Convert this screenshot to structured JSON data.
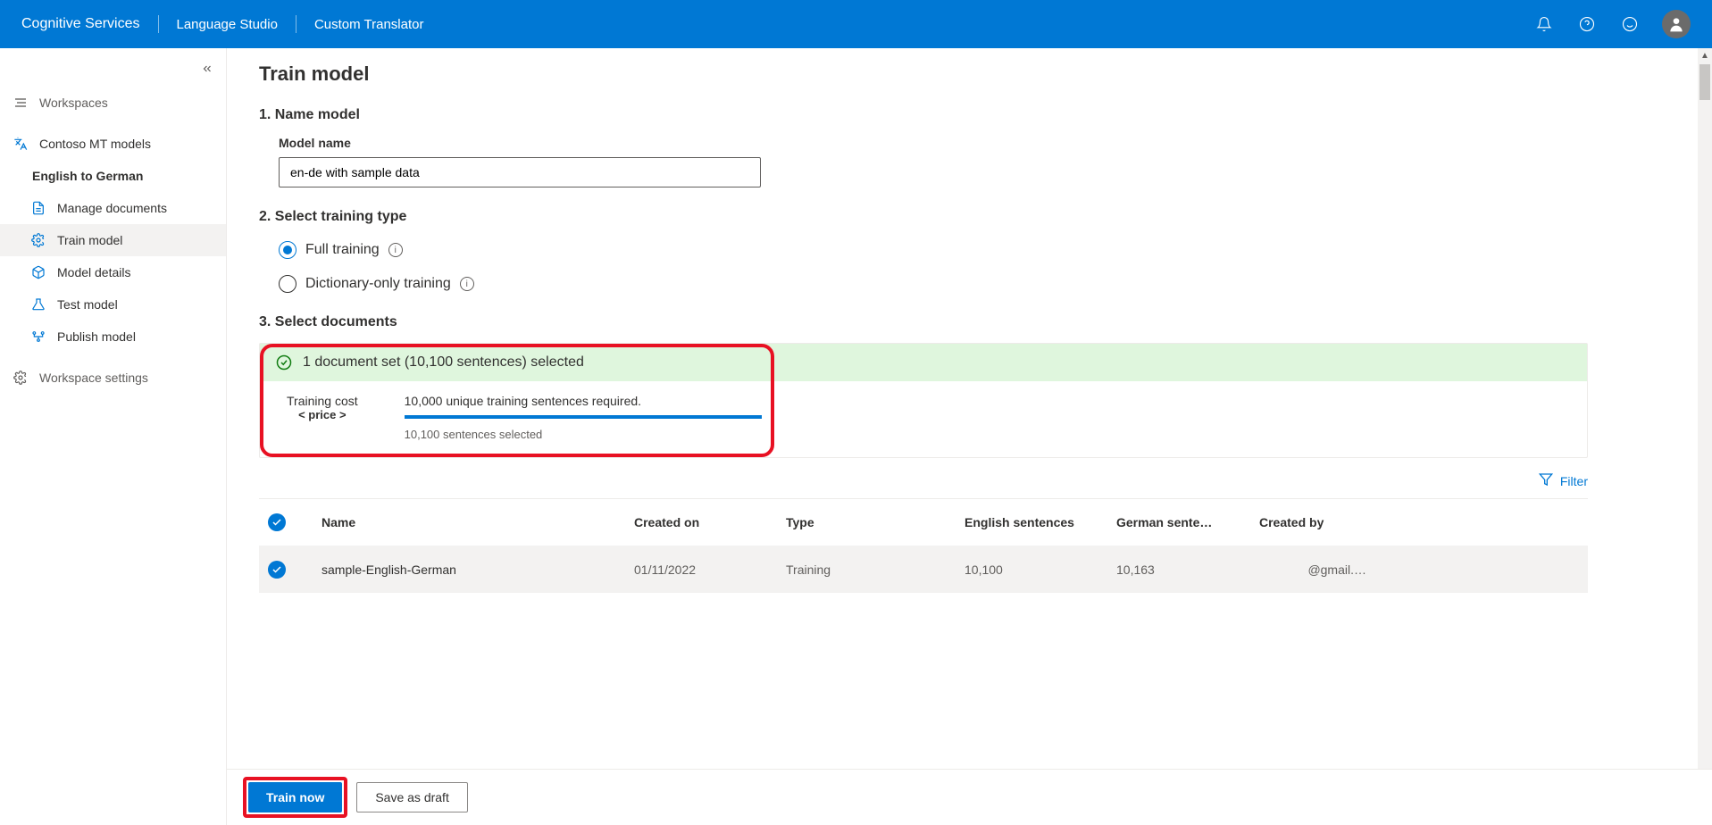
{
  "header": {
    "breadcrumbs": [
      "Cognitive Services",
      "Language Studio",
      "Custom Translator"
    ]
  },
  "sidebar": {
    "workspaces_label": "Workspaces",
    "workspace_name": "Contoso MT models",
    "project_name": "English to German",
    "items": [
      {
        "label": "Manage documents"
      },
      {
        "label": "Train model"
      },
      {
        "label": "Model details"
      },
      {
        "label": "Test model"
      },
      {
        "label": "Publish model"
      }
    ],
    "settings_label": "Workspace settings"
  },
  "page": {
    "title": "Train model",
    "step1": {
      "heading": "1. Name model",
      "field_label": "Model name",
      "value": "en-de with sample data"
    },
    "step2": {
      "heading": "2. Select training type",
      "options": [
        {
          "label": "Full training",
          "selected": true
        },
        {
          "label": "Dictionary-only training",
          "selected": false
        }
      ]
    },
    "step3": {
      "heading": "3. Select documents",
      "banner": "1 document set (10,100 sentences) selected",
      "cost_label": "Training cost",
      "cost_value": "< price >",
      "progress_req": "10,000 unique training sentences required.",
      "progress_sub": "10,100 sentences selected",
      "filter_label": "Filter",
      "table": {
        "headers": [
          "Name",
          "Created on",
          "Type",
          "English sentences",
          "German sente…",
          "Created by"
        ],
        "rows": [
          {
            "name": "sample-English-German",
            "created": "01/11/2022",
            "type": "Training",
            "eng": "10,100",
            "ger": "10,163",
            "by": "@gmail.…"
          }
        ]
      }
    },
    "footer": {
      "primary": "Train now",
      "secondary": "Save as draft"
    }
  }
}
